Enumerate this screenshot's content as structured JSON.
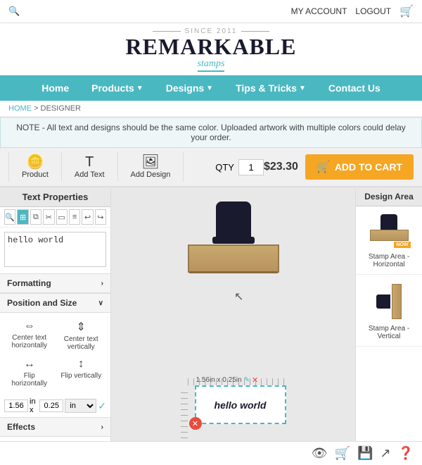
{
  "topbar": {
    "search_placeholder": "Search",
    "my_account": "MY ACCOUNT",
    "logout": "LOGOUT"
  },
  "logo": {
    "since": "SINCE 2011",
    "main": "REMARKABLE",
    "sub": "stamps"
  },
  "nav": {
    "items": [
      {
        "label": "Home",
        "has_arrow": false
      },
      {
        "label": "Products",
        "has_arrow": true
      },
      {
        "label": "Designs",
        "has_arrow": true
      },
      {
        "label": "Tips & Tricks",
        "has_arrow": true
      },
      {
        "label": "Contact Us",
        "has_arrow": false
      }
    ]
  },
  "breadcrumb": {
    "home": "HOME",
    "separator": " > ",
    "current": "DESIGNER"
  },
  "note": {
    "text": "NOTE - All text and designs should be the same color. Uploaded artwork with multiple colors could delay your order."
  },
  "toolbar": {
    "product_label": "Product",
    "add_text_label": "Add Text",
    "add_design_label": "Add Design",
    "qty_label": "QTY",
    "qty_value": "1",
    "price": "$23.30",
    "add_to_cart": "ADD TO CART"
  },
  "left_panel": {
    "title": "Text Properties",
    "text_value": "hello world",
    "formatting_label": "Formatting",
    "position_size_label": "Position and Size",
    "align": {
      "center_h": "Center text\nhorizontally",
      "center_v": "Center text\nvertically",
      "flip_h": "Flip\nhorizontally",
      "flip_v": "Flip vertically"
    },
    "size": {
      "width": "1.56",
      "height": "0.25",
      "unit": "in"
    },
    "effects_label": "Effects"
  },
  "design_preview": {
    "label": "1.56in x 0.25in",
    "text": "hello world"
  },
  "right_panel": {
    "title": "Design Area",
    "options": [
      {
        "label": "Stamp Area -\nHorizontal"
      },
      {
        "label": "Stamp Area -\nVertical"
      }
    ]
  },
  "bottom_icons": [
    "eye",
    "cart",
    "save",
    "share",
    "help"
  ]
}
